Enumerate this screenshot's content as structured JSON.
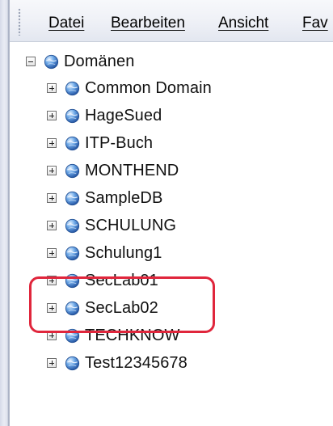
{
  "menu": {
    "items": [
      {
        "label": "Datei"
      },
      {
        "label": "Bearbeiten"
      },
      {
        "label": "Ansicht"
      },
      {
        "label": "Fav"
      }
    ]
  },
  "tree": {
    "root": {
      "label": "Domänen",
      "expanded": true,
      "icon": "globe-icon"
    },
    "children": [
      {
        "label": "Common Domain",
        "icon": "globe-icon"
      },
      {
        "label": "HageSued",
        "icon": "globe-icon"
      },
      {
        "label": "ITP-Buch",
        "icon": "globe-icon"
      },
      {
        "label": "MONTHEND",
        "icon": "globe-icon"
      },
      {
        "label": "SampleDB",
        "icon": "globe-icon"
      },
      {
        "label": "SCHULUNG",
        "icon": "globe-icon"
      },
      {
        "label": "Schulung1",
        "icon": "globe-icon"
      },
      {
        "label": "SecLab01",
        "icon": "globe-icon"
      },
      {
        "label": "SecLab02",
        "icon": "globe-icon"
      },
      {
        "label": "TECHKNOW",
        "icon": "globe-icon"
      },
      {
        "label": "Test12345678",
        "icon": "globe-icon"
      }
    ]
  },
  "highlight": {
    "color": "#e0263c",
    "items": [
      "SecLab01",
      "SecLab02"
    ]
  }
}
